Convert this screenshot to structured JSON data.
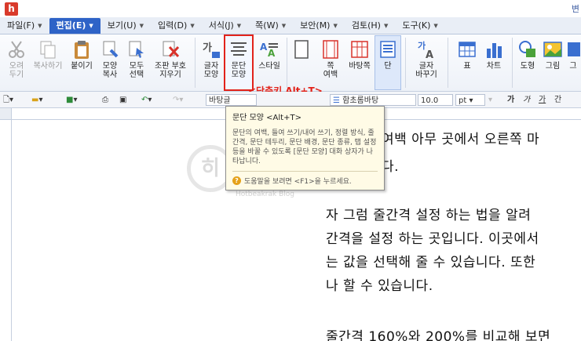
{
  "title": {
    "logo": "h",
    "text": "변"
  },
  "menu": [
    {
      "label": "파일(F)",
      "active": false
    },
    {
      "label": "편집(E)",
      "active": true
    },
    {
      "label": "보기(U)",
      "active": false
    },
    {
      "label": "입력(D)",
      "active": false
    },
    {
      "label": "서식(J)",
      "active": false
    },
    {
      "label": "쪽(W)",
      "active": false
    },
    {
      "label": "보안(M)",
      "active": false
    },
    {
      "label": "검토(H)",
      "active": false
    },
    {
      "label": "도구(K)",
      "active": false
    }
  ],
  "ribbon": {
    "cut": "오려\n두기",
    "copy": "복사하기",
    "paste": "붙이기",
    "format_copy": "모양\n복사",
    "select_all": "모두\n선택",
    "glyph": "조판 부호\n지우기",
    "char_shape": "글자\n모양",
    "para_shape": "문단\n모양",
    "style": "스타일",
    "page_margin": "쪽\n여백",
    "paper": "바탕쪽",
    "column": "단",
    "text_wrap": "글자\n바꾸기",
    "table": "표",
    "chart": "차트",
    "shape": "도형",
    "picture": "그림",
    "graphic": "그"
  },
  "shortcut_note": "<단축키 Alt+T>",
  "format_bar": {
    "style": "바탕글",
    "font": "함초롬바탕",
    "size": "10.0",
    "unit": "pt",
    "bold": "가",
    "italic": "가",
    "underline": "가",
    "strike": "간"
  },
  "tooltip": {
    "title": "문단 모양 <Alt+T>",
    "body": "문단의 여백, 들여 쓰기/내어 쓰기, 정렬 방식, 줄 간격, 문단 테두리, 문단 배경, 문단 종류, 탭 설정 등을 바꿀 수 있도록 [문단 모양] 대화 상자가 나타납니다.",
    "help": "도움말을 보려면 <F1>을 누르세요."
  },
  "document": {
    "lines": [
      "여백 아무 곳에서 오른쪽 마",
      "다.",
      "자 그럼 줄간격 설정 하는 법을 알려",
      "간격을 설정 하는 곳입니다. 이곳에서",
      "는 값을 선택해 줄 수 있습니다. 또한",
      "나 할 수 있습니다.",
      "줄간격 160%와 200%를 비교해 보면"
    ]
  },
  "watermark": {
    "mark": "히",
    "text": "Hotbeakrak Blog"
  }
}
